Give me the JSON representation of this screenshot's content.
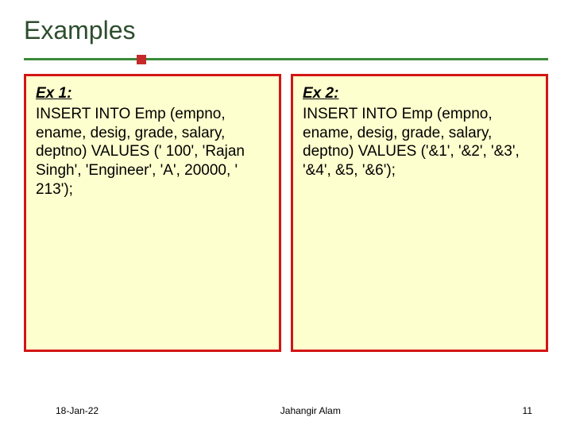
{
  "title": "Examples",
  "boxes": [
    {
      "heading": "Ex 1:",
      "body": "INSERT INTO Emp (empno, ename, desig, grade, salary, deptno) VALUES (' 100', 'Rajan Singh', 'Engineer', 'A', 20000, ' 213');"
    },
    {
      "heading": "Ex 2:",
      "body": "INSERT INTO Emp (empno, ename, desig, grade, salary, deptno) VALUES ('&1', '&2', '&3', '&4', &5, '&6');"
    }
  ],
  "footer": {
    "date": "18-Jan-22",
    "author": "Jahangir Alam",
    "page": "11"
  }
}
